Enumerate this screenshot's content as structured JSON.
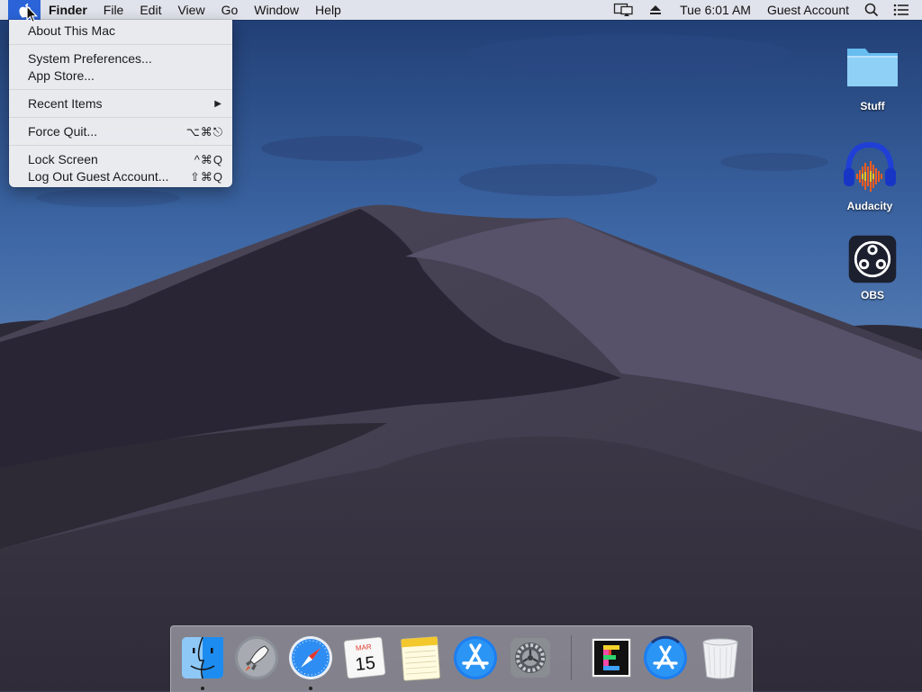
{
  "menubar": {
    "apple_menu_open": true,
    "items": [
      "Finder",
      "File",
      "Edit",
      "View",
      "Go",
      "Window",
      "Help"
    ],
    "clock": "Tue 6:01 AM",
    "user": "Guest Account",
    "accent": "#2b64d9"
  },
  "apple_menu": {
    "about": "About This Mac",
    "system_prefs": "System Preferences...",
    "app_store": "App Store...",
    "recent_items": "Recent Items",
    "force_quit": "Force Quit...",
    "force_quit_shortcut": "⌥⌘⎋",
    "lock_screen": "Lock Screen",
    "lock_screen_shortcut": "^⌘Q",
    "log_out": "Log Out Guest Account...",
    "log_out_shortcut": "⇧⌘Q"
  },
  "desktop_icons": [
    {
      "label": "Stuff",
      "icon": "folder-icon"
    },
    {
      "label": "Audacity",
      "icon": "audacity-icon"
    },
    {
      "label": "OBS",
      "icon": "obs-icon"
    }
  ],
  "dock": {
    "apps": [
      {
        "name": "Finder",
        "icon": "finder-icon",
        "running": true
      },
      {
        "name": "Launchpad",
        "icon": "launchpad-icon",
        "running": false
      },
      {
        "name": "Safari",
        "icon": "safari-icon",
        "running": true
      },
      {
        "name": "Calendar",
        "icon": "calendar-icon",
        "running": false,
        "month": "MAR",
        "day": "15"
      },
      {
        "name": "Notes",
        "icon": "notes-icon",
        "running": false
      },
      {
        "name": "App Store",
        "icon": "app-store-icon",
        "running": false
      },
      {
        "name": "System Preferences",
        "icon": "system-preferences-icon",
        "running": false
      },
      {
        "name": "Editor",
        "icon": "e-app-icon",
        "running": false
      },
      {
        "name": "App Store Download",
        "icon": "app-store-download-icon",
        "running": false
      },
      {
        "name": "Trash",
        "icon": "trash-icon",
        "running": false
      }
    ]
  }
}
